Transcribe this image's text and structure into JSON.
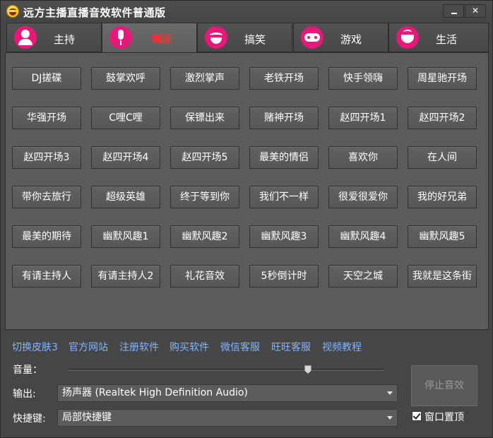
{
  "window": {
    "title": "远方主播直播音效软件普通版"
  },
  "tabs": [
    {
      "label": "主持",
      "icon": "host-icon",
      "active": false
    },
    {
      "label": "喊麦",
      "icon": "microphone-icon",
      "active": true
    },
    {
      "label": "搞笑",
      "icon": "laugh-icon",
      "active": false
    },
    {
      "label": "游戏",
      "icon": "gamepad-icon",
      "active": false
    },
    {
      "label": "生活",
      "icon": "life-icon",
      "active": false
    }
  ],
  "buttons": [
    [
      "DJ搓碟",
      "鼓掌欢呼",
      "激烈掌声",
      "老铁开场",
      "快手领嗨",
      "周星驰开场"
    ],
    [
      "华强开场",
      "C哩C哩",
      "保镖出来",
      "赌神开场",
      "赵四开场1",
      "赵四开场2"
    ],
    [
      "赵四开场3",
      "赵四开场4",
      "赵四开场5",
      "最美的情侣",
      "喜欢你",
      "在人间"
    ],
    [
      "带你去旅行",
      "超级英雄",
      "终于等到你",
      "我们不一样",
      "很爱很爱你",
      "我的好兄弟"
    ],
    [
      "最美的期待",
      "幽默风趣1",
      "幽默风趣2",
      "幽默风趣3",
      "幽默风趣4",
      "幽默风趣5"
    ],
    [
      "有请主持人",
      "有请主持人2",
      "礼花音效",
      "5秒倒计时",
      "天空之城",
      "我就是这条街"
    ]
  ],
  "links": [
    "切换皮肤3",
    "官方网站",
    "注册软件",
    "购买软件",
    "微信客服",
    "旺旺客服",
    "视频教程"
  ],
  "controls": {
    "volume_label": "音量：",
    "volume_level": 0.76,
    "output_label": "输出:",
    "output_value": "扬声器 (Realtek High Definition Audio)",
    "hotkey_label": "快捷键:",
    "hotkey_value": "局部快捷键",
    "stop_label": "停止音效",
    "topmost_label": "窗口置顶",
    "topmost_checked": true
  },
  "colors": {
    "accent": "#e8187a",
    "active_tab_text": "#ff2d2d",
    "link": "#7fb6ff"
  }
}
